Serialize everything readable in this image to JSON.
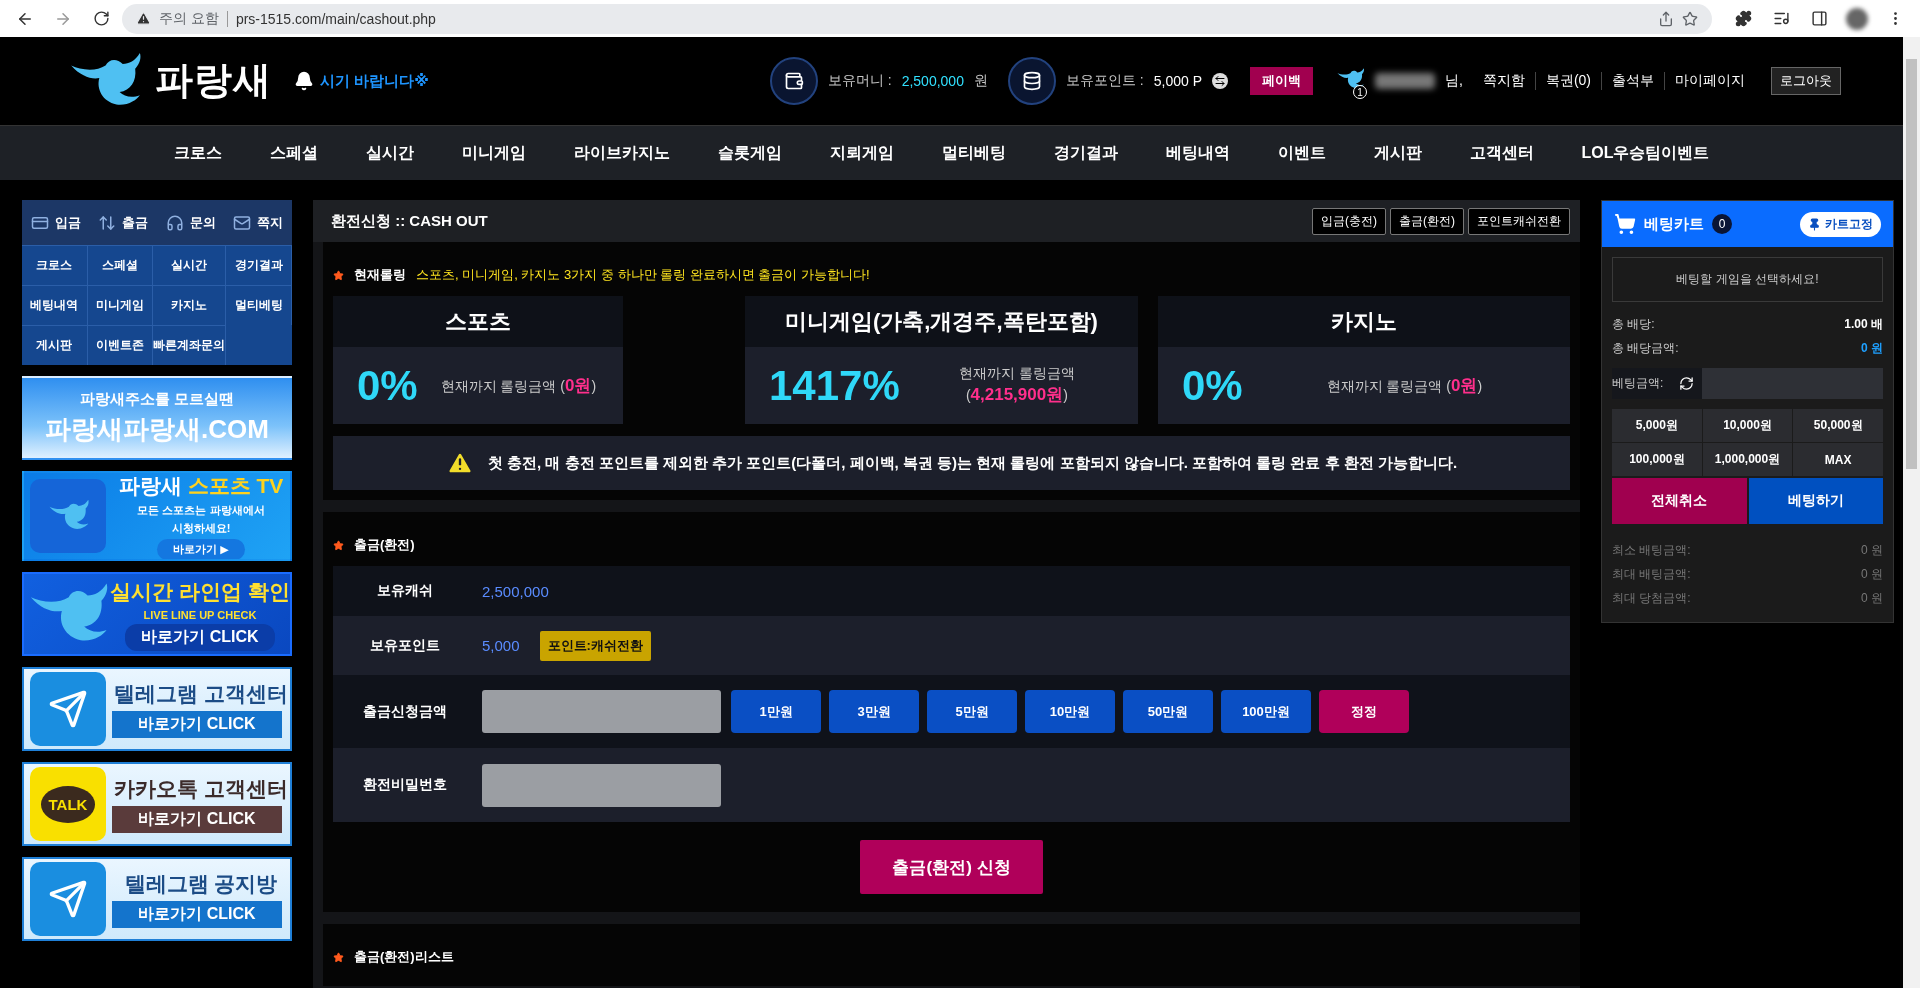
{
  "browser": {
    "security_label": "주의 요함",
    "url": "prs-1515.com/main/cashout.php"
  },
  "header": {
    "logo": "파랑새",
    "ticker": "시기 바랍니다※",
    "money_label": "보유머니 :",
    "money_value": "2,500,000",
    "money_unit": "원",
    "point_label": "보유포인트 :",
    "point_value": "5,000 P",
    "payback": "페이백",
    "message_count": "1",
    "name_suffix": "님,",
    "links": [
      "쪽지함",
      "복권(0)",
      "출석부",
      "마이페이지"
    ],
    "logout": "로그아웃"
  },
  "nav": [
    "크로스",
    "스페셜",
    "실시간",
    "미니게임",
    "라이브카지노",
    "슬롯게임",
    "지뢰게임",
    "멀티베팅",
    "경기결과",
    "베팅내역",
    "이벤트",
    "게시판",
    "고객센터",
    "LOL우승팀이벤트"
  ],
  "sidebar": {
    "quick": [
      {
        "kind": "deposit",
        "label": "입금"
      },
      {
        "kind": "withdraw",
        "label": "출금"
      },
      {
        "kind": "support",
        "label": "문의"
      },
      {
        "kind": "message",
        "label": "쪽지"
      }
    ],
    "menu": [
      "크로스",
      "스페셜",
      "실시간",
      "경기결과",
      "베팅내역",
      "미니게임",
      "카지노",
      "멀티베팅",
      "게시판",
      "이벤트존",
      "빠른계좌문의"
    ],
    "banners": [
      {
        "kind": "address",
        "subtitle": "파랑새주소를 모르실땐",
        "title": "파랑새파랑새.COM"
      },
      {
        "kind": "tv",
        "title": "파랑새 **스포츠 TV**",
        "subtitle": "모든 스포츠는 파랑새에서",
        "subtitle2": "시청하세요!",
        "button": "바로가기 ▶"
      },
      {
        "kind": "lineup",
        "title": "실시간 라인업 확인",
        "subtitle": "LIVE LINE UP CHECK",
        "button": "바로가기 CLICK"
      },
      {
        "kind": "telegram",
        "title": "텔레그램 고객센터",
        "button": "바로가기 CLICK"
      },
      {
        "kind": "kakao",
        "icon_text": "TALK",
        "title": "카카오톡 고객센터",
        "button": "바로가기 CLICK"
      },
      {
        "kind": "notice",
        "title": "텔레그램 공지방",
        "button": "바로가기 CLICK"
      }
    ]
  },
  "cashout": {
    "title": "환전신청 :: CASH OUT",
    "tabs": [
      "입금(충전)",
      "출금(환전)",
      "포인트캐쉬전환"
    ],
    "rolling": {
      "heading": "현재롤링",
      "notice": "스포츠, 미니게임, 카지노 3가지 중 하나만 롤링 완료하시면 출금이 가능합니다!",
      "cards": [
        {
          "title": "스포츠",
          "percent": "0%",
          "amount": "현재까지 롤링금액 (**0원**)"
        },
        {
          "title": "미니게임(가축,개경주,폭탄포함)",
          "percent": "1417%",
          "amount": "현재까지 롤링금액 (**4,215,900원**)"
        },
        {
          "title": "카지노",
          "percent": "0%",
          "amount": "현재까지 롤링금액 (**0원**)"
        }
      ],
      "warning": "첫 충전, 매 충전 포인트를 제외한 추가 포인트(다폴더, 페이백, 복권 등)는 현재 롤링에 포함되지 않습니다. 포함하여 롤링 완료 후 환전 가능합니다."
    },
    "withdraw": {
      "heading": "출금(환전)",
      "rows": [
        {
          "kind": "value",
          "label": "보유캐쉬",
          "value": "2,500,000"
        },
        {
          "kind": "value",
          "label": "보유포인트",
          "value": "5,000",
          "button": "포인트:캐쉬전환"
        },
        {
          "kind": "amount",
          "label": "출금신청금액",
          "buttons": [
            "1만원",
            "3만원",
            "5만원",
            "10만원",
            "50만원",
            "100만원"
          ],
          "reset": "정정"
        },
        {
          "kind": "password",
          "label": "환전비밀번호"
        }
      ],
      "submit": "출금(환전) 신청"
    },
    "list": {
      "heading": "출금(환전)리스트"
    }
  },
  "cart": {
    "title": "베팅카트",
    "count": "0",
    "pin": "카트고정",
    "empty": "베팅할 게임을 선택하세요!",
    "totals": [
      {
        "kind": "plain",
        "label": "총 배당:",
        "value": "1.00 배"
      },
      {
        "kind": "accent",
        "label": "총 배당금액:",
        "value": "0 원"
      }
    ],
    "amount_label": "베팅금액:",
    "chips": [
      "5,000원",
      "10,000원",
      "50,000원",
      "100,000원",
      "1,000,000원",
      "MAX"
    ],
    "cancel": "전체취소",
    "bet": "베팅하기",
    "limits": [
      {
        "label": "최소 배팅금액:",
        "value": "0 원"
      },
      {
        "label": "최대 배팅금액:",
        "value": "0 원"
      },
      {
        "label": "최대 당첨금액:",
        "value": "0 원"
      }
    ]
  }
}
